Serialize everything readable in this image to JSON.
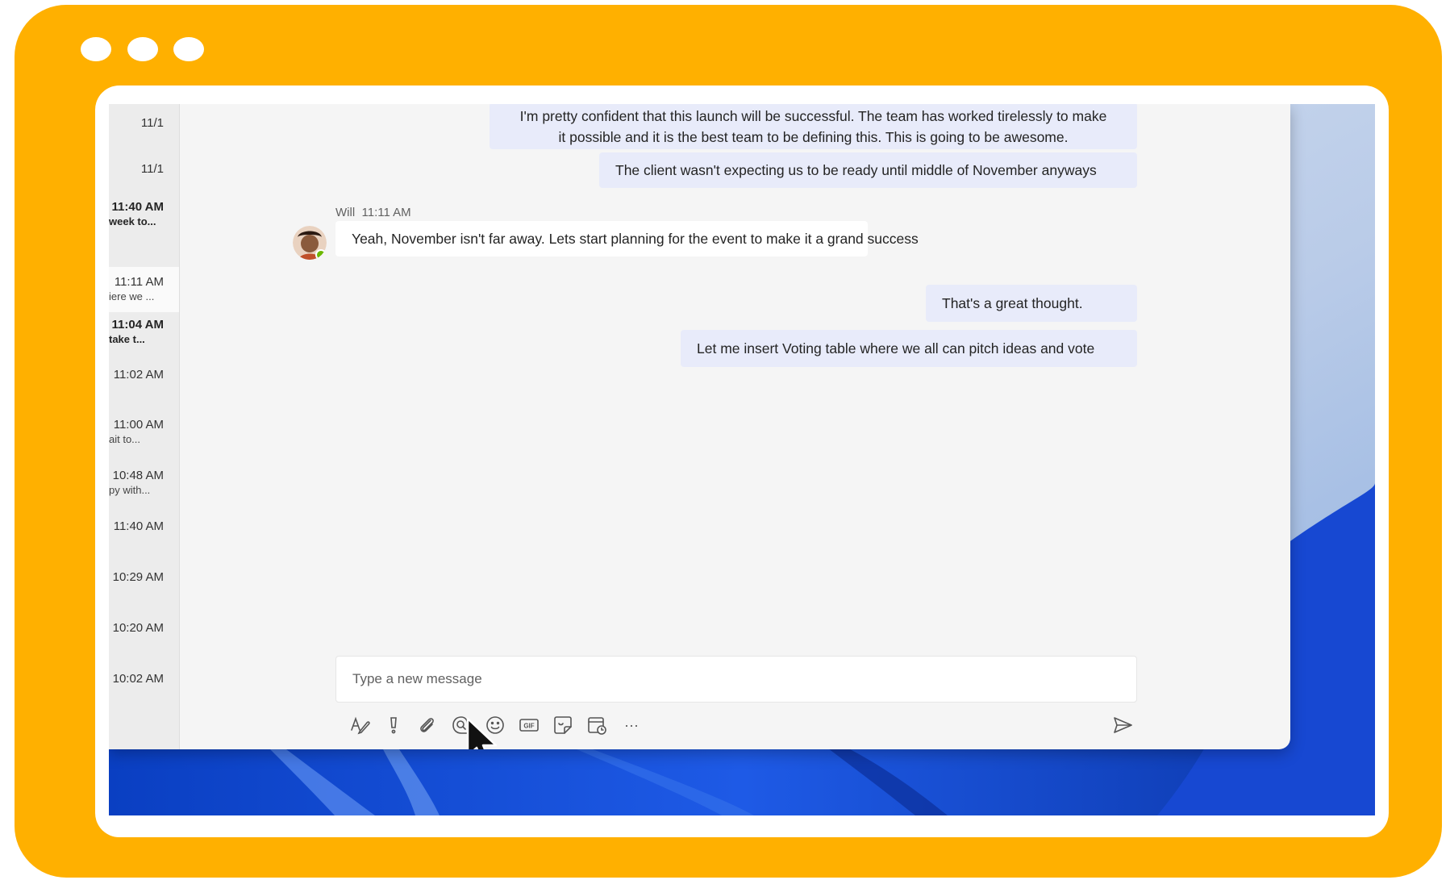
{
  "chat_list": {
    "items": [
      {
        "time": "11/1",
        "preview": ""
      },
      {
        "time": "11/1",
        "preview": ""
      },
      {
        "time": "11:40 AM",
        "preview": "week to..."
      },
      {
        "time": "11:11 AM",
        "preview": "iere we ..."
      },
      {
        "time": "11:04 AM",
        "preview": "take t..."
      },
      {
        "time": "11:02 AM",
        "preview": ""
      },
      {
        "time": "11:00 AM",
        "preview": "ait to..."
      },
      {
        "time": "10:48 AM",
        "preview": "py with..."
      },
      {
        "time": "11:40 AM",
        "preview": ""
      },
      {
        "time": "10:29 AM",
        "preview": ""
      },
      {
        "time": "10:20 AM",
        "preview": ""
      },
      {
        "time": "10:02 AM",
        "preview": ""
      }
    ]
  },
  "messages": {
    "m1_line1": "I'm pretty confident that this launch will be successful. The team has worked tirelessly to make",
    "m1_line2": "it possible and it is the best team to be defining this. This is going to be awesome.",
    "m2": "The client wasn't expecting us to be ready until middle of November anyways",
    "will_name": "Will",
    "will_time": "11:11 AM",
    "m3": "Yeah, November isn't far away. Lets start planning for the event to make it a grand success",
    "m4": "That's a great thought.",
    "m5": "Let me insert Voting table where we all can pitch ideas and vote"
  },
  "compose": {
    "placeholder": "Type a new message"
  },
  "toolbar": {
    "icons": [
      "format-icon",
      "important-icon",
      "attach-icon",
      "loop-icon",
      "emoji-icon",
      "gif-icon",
      "sticker-icon",
      "schedule-icon",
      "more-icon"
    ],
    "gif_label": "GIF",
    "more_label": "···"
  },
  "colors": {
    "frame": "#FFB000",
    "own_bubble": "#e8ebfa",
    "other_bubble": "#ffffff",
    "accent": "#5b5fc7"
  }
}
